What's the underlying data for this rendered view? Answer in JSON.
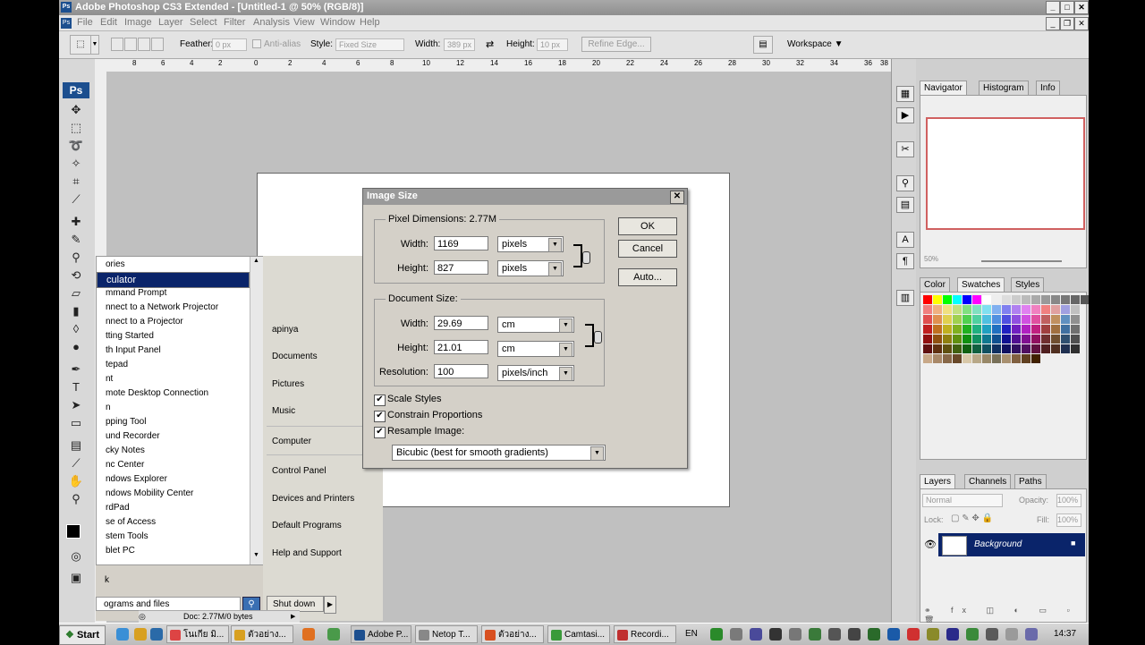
{
  "titlebar": {
    "title": "Adobe Photoshop CS3 Extended - [Untitled-1 @ 50% (RGB/8)]",
    "app_icon": "Ps"
  },
  "menu": [
    "File",
    "Edit",
    "Image",
    "Layer",
    "Select",
    "Filter",
    "Analysis",
    "View",
    "Window",
    "Help"
  ],
  "options": {
    "feather_label": "Feather:",
    "feather_value": "0 px",
    "antialias_label": "Anti-alias",
    "style_label": "Style:",
    "style_value": "Fixed Size",
    "width_label": "Width:",
    "width_value": "389 px",
    "height_label": "Height:",
    "height_value": "10 px",
    "refine_label": "Refine Edge...",
    "workspace_label": "Workspace ▼"
  },
  "ruler_labels": [
    "8",
    "6",
    "4",
    "2",
    "0",
    "2",
    "4",
    "6",
    "8",
    "10",
    "12",
    "14",
    "16",
    "18",
    "20",
    "22",
    "24",
    "26",
    "28",
    "30",
    "32",
    "34",
    "36",
    "38"
  ],
  "toolbox": {
    "logo": "Ps"
  },
  "panels": {
    "nav_tabs": [
      "Navigator",
      "Histogram",
      "Info"
    ],
    "nav_zoom": "50%",
    "color_tabs": [
      "Color",
      "Swatches",
      "Styles"
    ],
    "layer_tabs": [
      "Layers",
      "Channels",
      "Paths"
    ],
    "blend_mode": "Normal",
    "opacity_label": "Opacity:",
    "opacity_value": "100%",
    "lock_label": "Lock:",
    "fill_label": "Fill:",
    "fill_value": "100%",
    "layer_name": "Background"
  },
  "start_menu": {
    "programs": [
      "ories",
      "culator",
      "mmand Prompt",
      "nnect to a Network Projector",
      "nnect to a Projector",
      "tting Started",
      "th Input Panel",
      "tepad",
      "nt",
      "mote Desktop Connection",
      "n",
      "pping Tool",
      "und Recorder",
      "cky Notes",
      "nc Center",
      "ndows Explorer",
      "ndows Mobility Center",
      "rdPad",
      "se of Access",
      "stem Tools",
      "blet PC"
    ],
    "back": "k",
    "search_placeholder": "ograms and files",
    "right_items": [
      "apinya",
      "Documents",
      "Pictures",
      "Music",
      "Computer",
      "Control Panel",
      "Devices and Printers",
      "Default Programs",
      "Help and Support"
    ],
    "shutdown": "Shut down"
  },
  "status": {
    "doc": "Doc: 2.77M/0 bytes"
  },
  "dialog": {
    "title": "Image Size",
    "pixel_dim_label": "Pixel Dimensions:",
    "pixel_dim_value": "2.77M",
    "px_width_label": "Width:",
    "px_width": "1169",
    "px_width_unit": "pixels",
    "px_height_label": "Height:",
    "px_height": "827",
    "px_height_unit": "pixels",
    "doc_size_label": "Document Size:",
    "doc_width_label": "Width:",
    "doc_width": "29.69",
    "doc_width_unit": "cm",
    "doc_height_label": "Height:",
    "doc_height": "21.01",
    "doc_height_unit": "cm",
    "res_label": "Resolution:",
    "res_value": "100",
    "res_unit": "pixels/inch",
    "scale_styles": "Scale Styles",
    "constrain": "Constrain Proportions",
    "resample": "Resample Image:",
    "resample_method": "Bicubic (best for smooth gradients)",
    "ok": "OK",
    "cancel": "Cancel",
    "auto": "Auto..."
  },
  "taskbar": {
    "start": "Start",
    "tasks": [
      "โนเกีย มิ...",
      "ตัวอย่าง...",
      "Adobe P...",
      "Netop T...",
      "ตัวอย่าง...",
      "Camtasi...",
      "Recordi..."
    ],
    "lang": "EN",
    "clock": "14:37"
  },
  "colors": {
    "accent": "#0a246a",
    "layer_selected": "#0a246a",
    "ps_blue": "#1c4f8f"
  }
}
